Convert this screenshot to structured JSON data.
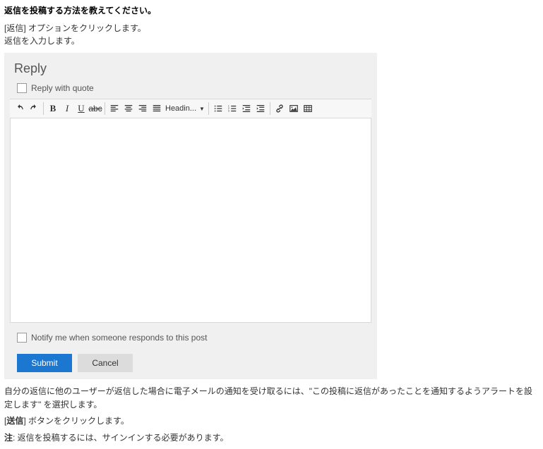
{
  "heading": "返信を投稿する方法を教えてください。",
  "steps": {
    "step1": "[返信] オプションをクリックします。",
    "step2": "返信を入力します。"
  },
  "reply_panel": {
    "title": "Reply",
    "reply_with_quote": "Reply with quote",
    "toolbar": {
      "undo": "undo",
      "redo": "redo",
      "bold": "B",
      "italic": "I",
      "underline": "U",
      "strike": "abc",
      "heading_label": "Headin...",
      "icons": {
        "align_left": "align-left",
        "align_center": "align-center",
        "align_right": "align-right",
        "align_justify": "align-justify",
        "list_ul": "list-ul",
        "list_ol": "list-ol",
        "outdent": "outdent",
        "indent": "indent",
        "link": "link",
        "image": "image",
        "table": "table"
      }
    },
    "notify_label": "Notify me when someone responds to this post",
    "submit": "Submit",
    "cancel": "Cancel"
  },
  "after": {
    "line1": "自分の返信に他のユーザーが返信した場合に電子メールの通知を受け取るには、\"この投稿に返信があったことを通知するようアラートを設定します\" を選択します。",
    "line2_prefix": "[",
    "line2_bold": "送信",
    "line2_suffix": "] ボタンをクリックします。",
    "note_bold": "注",
    "note_text": ": 返信を投稿するには、サインインする必要があります。"
  }
}
